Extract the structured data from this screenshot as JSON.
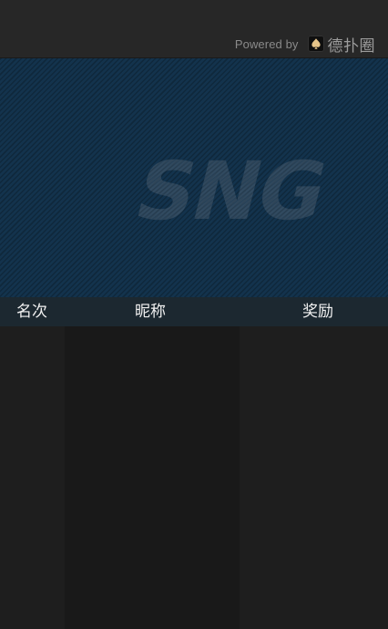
{
  "header": {
    "powered_by": "Powered by",
    "brand_name": "德扑圈",
    "brand_icon": "spade-icon"
  },
  "banner": {
    "logo_text": "SNG",
    "pattern": "diagonal-stripes",
    "color": "#13334d"
  },
  "table": {
    "columns": [
      {
        "key": "rank",
        "label": "名次"
      },
      {
        "key": "nickname",
        "label": "昵称"
      },
      {
        "key": "reward",
        "label": "奖励"
      }
    ],
    "rows": []
  },
  "colors": {
    "background": "#1f1f1f",
    "header_bar": "#272727",
    "table_header": "#1c2830",
    "brand_icon_gold": "#e7c58a"
  }
}
